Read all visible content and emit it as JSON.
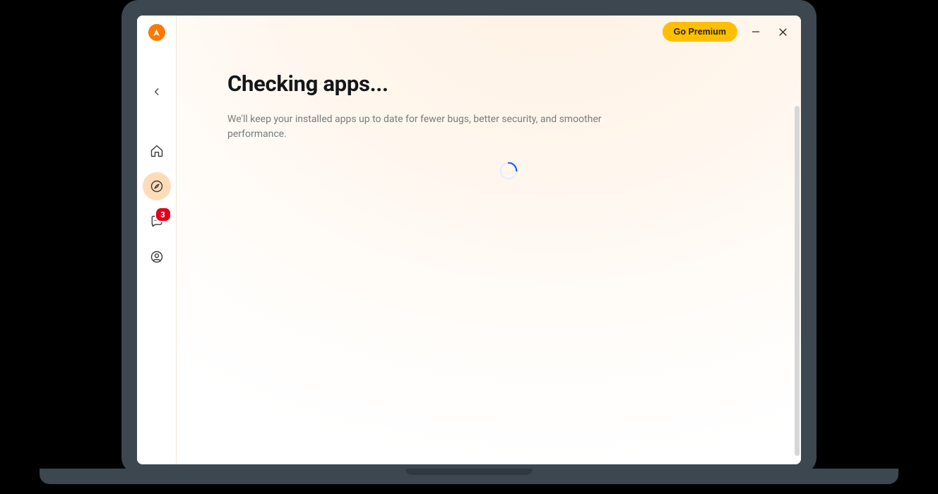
{
  "header": {
    "premium_label": "Go Premium"
  },
  "sidebar": {
    "notifications_count": "3"
  },
  "main": {
    "title": "Checking apps...",
    "subtitle": "We'll keep your installed apps up to date for fewer bugs, better security, and smoother performance."
  },
  "colors": {
    "accent": "#ff7800",
    "premium": "#ffbf00",
    "badge": "#e2001a",
    "spinner": "#1f62ff"
  }
}
